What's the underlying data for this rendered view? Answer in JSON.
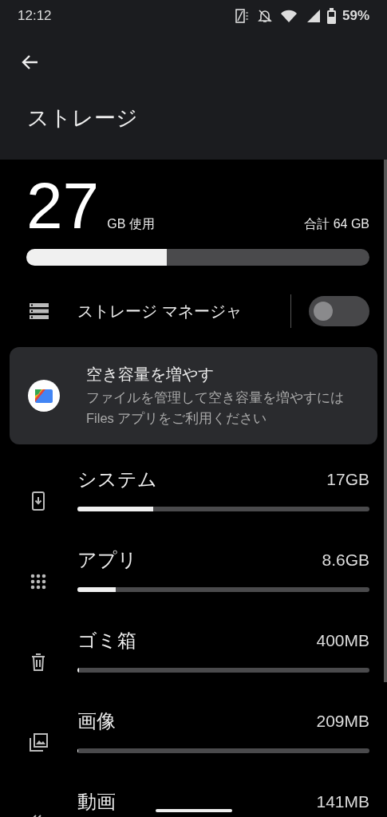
{
  "status_bar": {
    "time": "12:12",
    "battery": "59%"
  },
  "header": {
    "title": "ストレージ"
  },
  "summary": {
    "used": "27",
    "used_unit": "GB 使用",
    "total": "合計 64 GB",
    "level": 0.41
  },
  "storage_manager": {
    "label": "ストレージ マネージャ",
    "on": false
  },
  "promo": {
    "title": "空き容量を増やす",
    "body": "ファイルを管理して空き容量を増やすには Files アプリをご利用ください"
  },
  "categories": [
    {
      "kind": "system",
      "name": "システム",
      "size": "17GB",
      "level": 0.26
    },
    {
      "kind": "apps",
      "name": "アプリ",
      "size": "8.6GB",
      "level": 0.13
    },
    {
      "kind": "trash",
      "name": "ゴミ箱",
      "size": "400MB",
      "level": 0.006
    },
    {
      "kind": "images",
      "name": "画像",
      "size": "209MB",
      "level": 0.004
    },
    {
      "kind": "videos",
      "name": "動画",
      "size": "141MB"
    }
  ]
}
